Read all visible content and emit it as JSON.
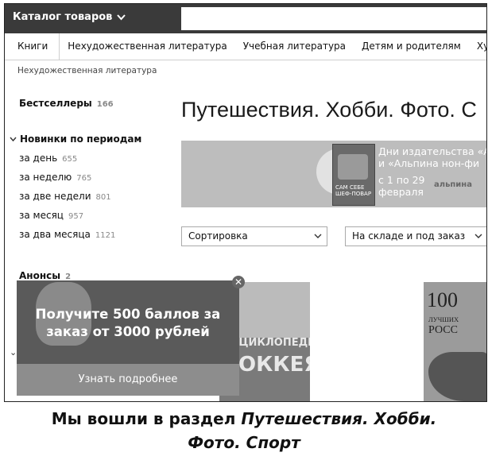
{
  "header": {
    "catalog_label": "Каталог товаров",
    "search_placeholder": ""
  },
  "nav": {
    "items": [
      "Книги",
      "Нехудожественная литература",
      "Учебная литература",
      "Детям и родителям",
      "Художе"
    ]
  },
  "breadcrumb": "Нехудожественная литература",
  "sidebar": {
    "bestsellers": {
      "label": "Бестселлеры",
      "count": "166"
    },
    "new_heading": "Новинки по периодам",
    "periods": [
      {
        "label": "за день",
        "count": "655"
      },
      {
        "label": "за неделю",
        "count": "765"
      },
      {
        "label": "за две недели",
        "count": "801"
      },
      {
        "label": "за месяц",
        "count": "957"
      },
      {
        "label": "за два месяца",
        "count": "1121"
      }
    ],
    "announce": {
      "label": "Анонсы",
      "count": "2"
    }
  },
  "page_title": "Путешествия. Хобби. Фото. С",
  "banner": {
    "line1": "Дни издательства «А",
    "line2": "и «Альпина нон-фи",
    "date1": "с 1 по 29",
    "date2": "февраля",
    "logo": "альпина",
    "book_text": "САМ СЕБЕ ШЕФ-ПОВАР"
  },
  "filters": {
    "sort": "Сортировка",
    "availability": "На складе и под заказ"
  },
  "promo": {
    "line1": "Получите 500 баллов за",
    "line2": "заказ от 3000 рублей",
    "button": "Узнать подробнее",
    "close": "✕"
  },
  "covers": {
    "hockey_title1": "ЭНЦИКЛОПЕДИЯ",
    "hockey_title2": "ХОККЕЯ",
    "book2_num": "100",
    "book2_line1": "ЛУЧШИХ",
    "book2_line2": "РОСС"
  },
  "caption": {
    "prefix": "Мы вошли в раздел ",
    "italic1": "Путешествия. Хобби.",
    "italic2": "Фото. Спорт"
  }
}
